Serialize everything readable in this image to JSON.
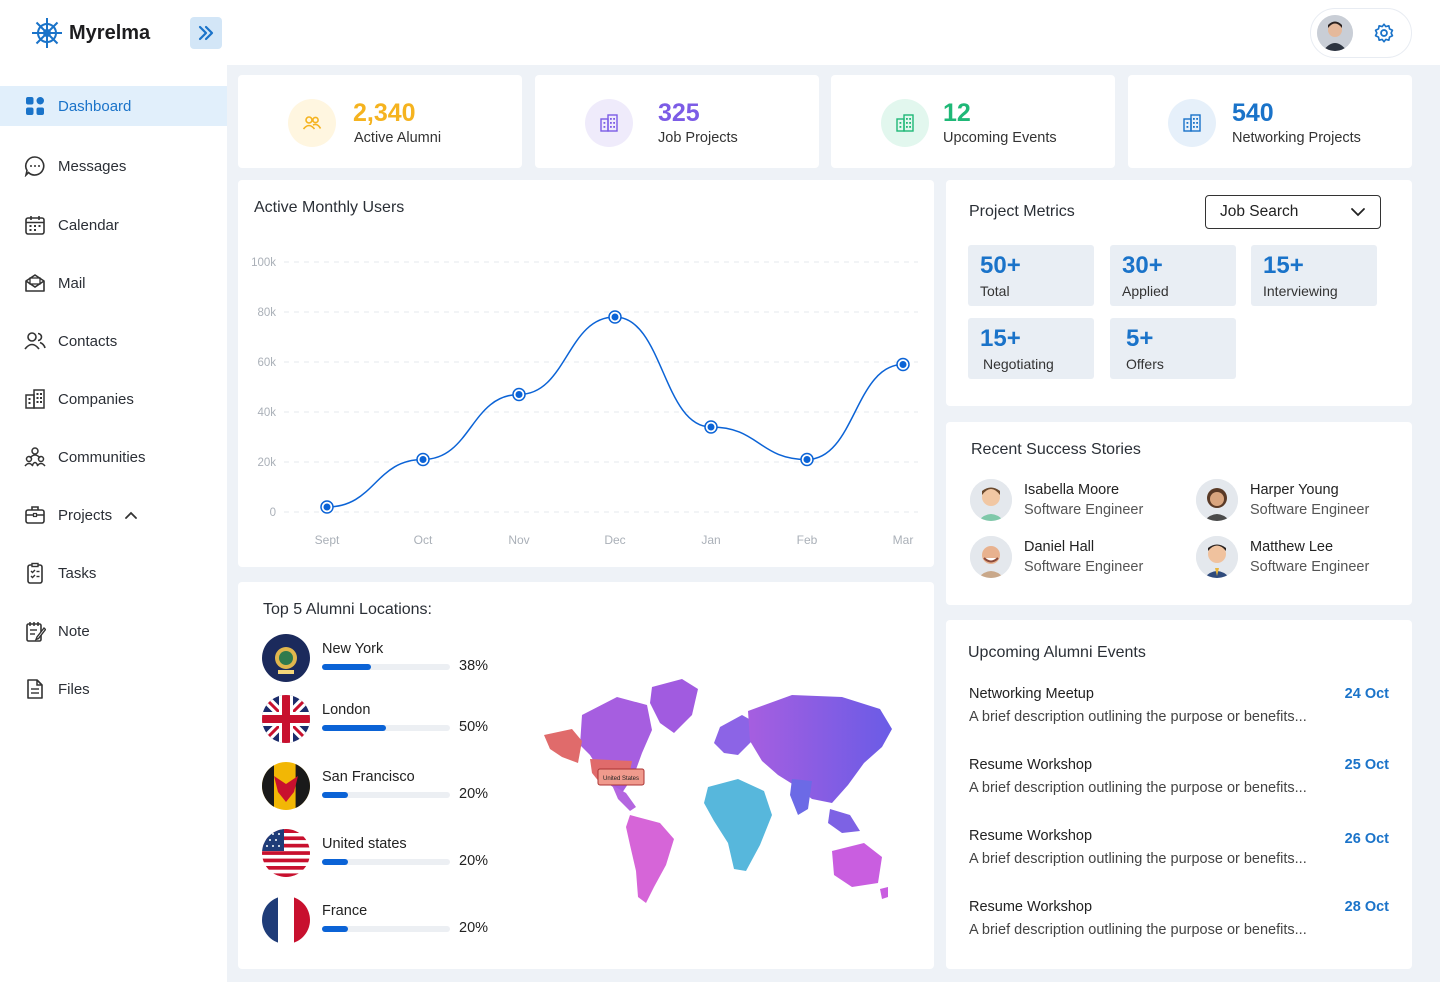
{
  "app": {
    "name": "Myrelma"
  },
  "sidebar": {
    "items": [
      {
        "label": "Dashboard",
        "icon": "dashboard-icon",
        "active": true
      },
      {
        "label": "Messages",
        "icon": "chat-icon"
      },
      {
        "label": "Calendar",
        "icon": "calendar-icon"
      },
      {
        "label": "Mail",
        "icon": "mail-icon"
      },
      {
        "label": "Contacts",
        "icon": "contacts-icon"
      },
      {
        "label": "Companies",
        "icon": "building-icon"
      },
      {
        "label": "Communities",
        "icon": "communities-icon"
      },
      {
        "label": "Projects",
        "icon": "briefcase-icon",
        "expanded": true
      },
      {
        "label": "Tasks",
        "icon": "clipboard-icon"
      },
      {
        "label": "Note",
        "icon": "note-icon"
      },
      {
        "label": "Files",
        "icon": "file-icon"
      }
    ]
  },
  "stats": [
    {
      "value": "2,340",
      "label": "Active Alumni",
      "color": "#f5b31f",
      "bg": "#fff6e0",
      "icon": "users-icon"
    },
    {
      "value": "325",
      "label": "Job Projects",
      "color": "#7c5ce6",
      "bg": "#efebfb",
      "icon": "building-icon"
    },
    {
      "value": "12",
      "label": "Upcoming Events",
      "color": "#1fb877",
      "bg": "#e2f7ee",
      "icon": "building-icon"
    },
    {
      "value": "540",
      "label": "Networking Projects",
      "color": "#1a73c9",
      "bg": "#e6f0fa",
      "icon": "building-icon"
    }
  ],
  "active_users": {
    "title": "Active Monthly Users"
  },
  "chart_data": {
    "type": "line",
    "title": "Active Monthly Users",
    "categories": [
      "Sept",
      "Oct",
      "Nov",
      "Dec",
      "Jan",
      "Feb",
      "Mar"
    ],
    "values": [
      2000,
      21000,
      47000,
      78000,
      34000,
      21000,
      59000
    ],
    "ylim": [
      0,
      100000
    ],
    "yticks": [
      "0",
      "20k",
      "40k",
      "60k",
      "80k",
      "100k"
    ],
    "color": "#0b63d6",
    "grid": true
  },
  "metrics": {
    "title": "Project Metrics",
    "dropdown": "Job Search",
    "items": [
      {
        "value": "50+",
        "label": "Total"
      },
      {
        "value": "30+",
        "label": "Applied"
      },
      {
        "value": "15+",
        "label": "Interviewing"
      },
      {
        "value": "15+",
        "label": "Negotiating"
      },
      {
        "value": "5+",
        "label": "Offers"
      }
    ]
  },
  "stories": {
    "title": "Recent Success Stories",
    "items": [
      {
        "name": "Isabella Moore",
        "role": "Software Engineer"
      },
      {
        "name": "Harper Young",
        "role": "Software Engineer"
      },
      {
        "name": "Daniel Hall",
        "role": "Software Engineer"
      },
      {
        "name": "Matthew Lee",
        "role": "Software Engineer"
      }
    ]
  },
  "locations": {
    "title": "Top 5 Alumni Locations:",
    "map_tooltip": "United States",
    "items": [
      {
        "name": "New York",
        "pct": "38%",
        "value": 0.38
      },
      {
        "name": "London",
        "pct": "50%",
        "value": 0.5
      },
      {
        "name": "San Francisco",
        "pct": "20%",
        "value": 0.2
      },
      {
        "name": "United states",
        "pct": "20%",
        "value": 0.2
      },
      {
        "name": "France",
        "pct": "20%",
        "value": 0.2
      }
    ]
  },
  "events": {
    "title": "Upcoming Alumni Events",
    "items": [
      {
        "title": "Networking Meetup",
        "date": "24 Oct",
        "desc": "A brief description outlining the purpose or benefits..."
      },
      {
        "title": "Resume Workshop",
        "date": "25 Oct",
        "desc": "A brief description outlining the purpose or benefits..."
      },
      {
        "title": "Resume Workshop",
        "date": "26 Oct",
        "desc": "A brief description outlining the purpose or benefits..."
      },
      {
        "title": "Resume Workshop",
        "date": "28 Oct",
        "desc": "A brief description outlining the purpose or benefits..."
      }
    ]
  }
}
